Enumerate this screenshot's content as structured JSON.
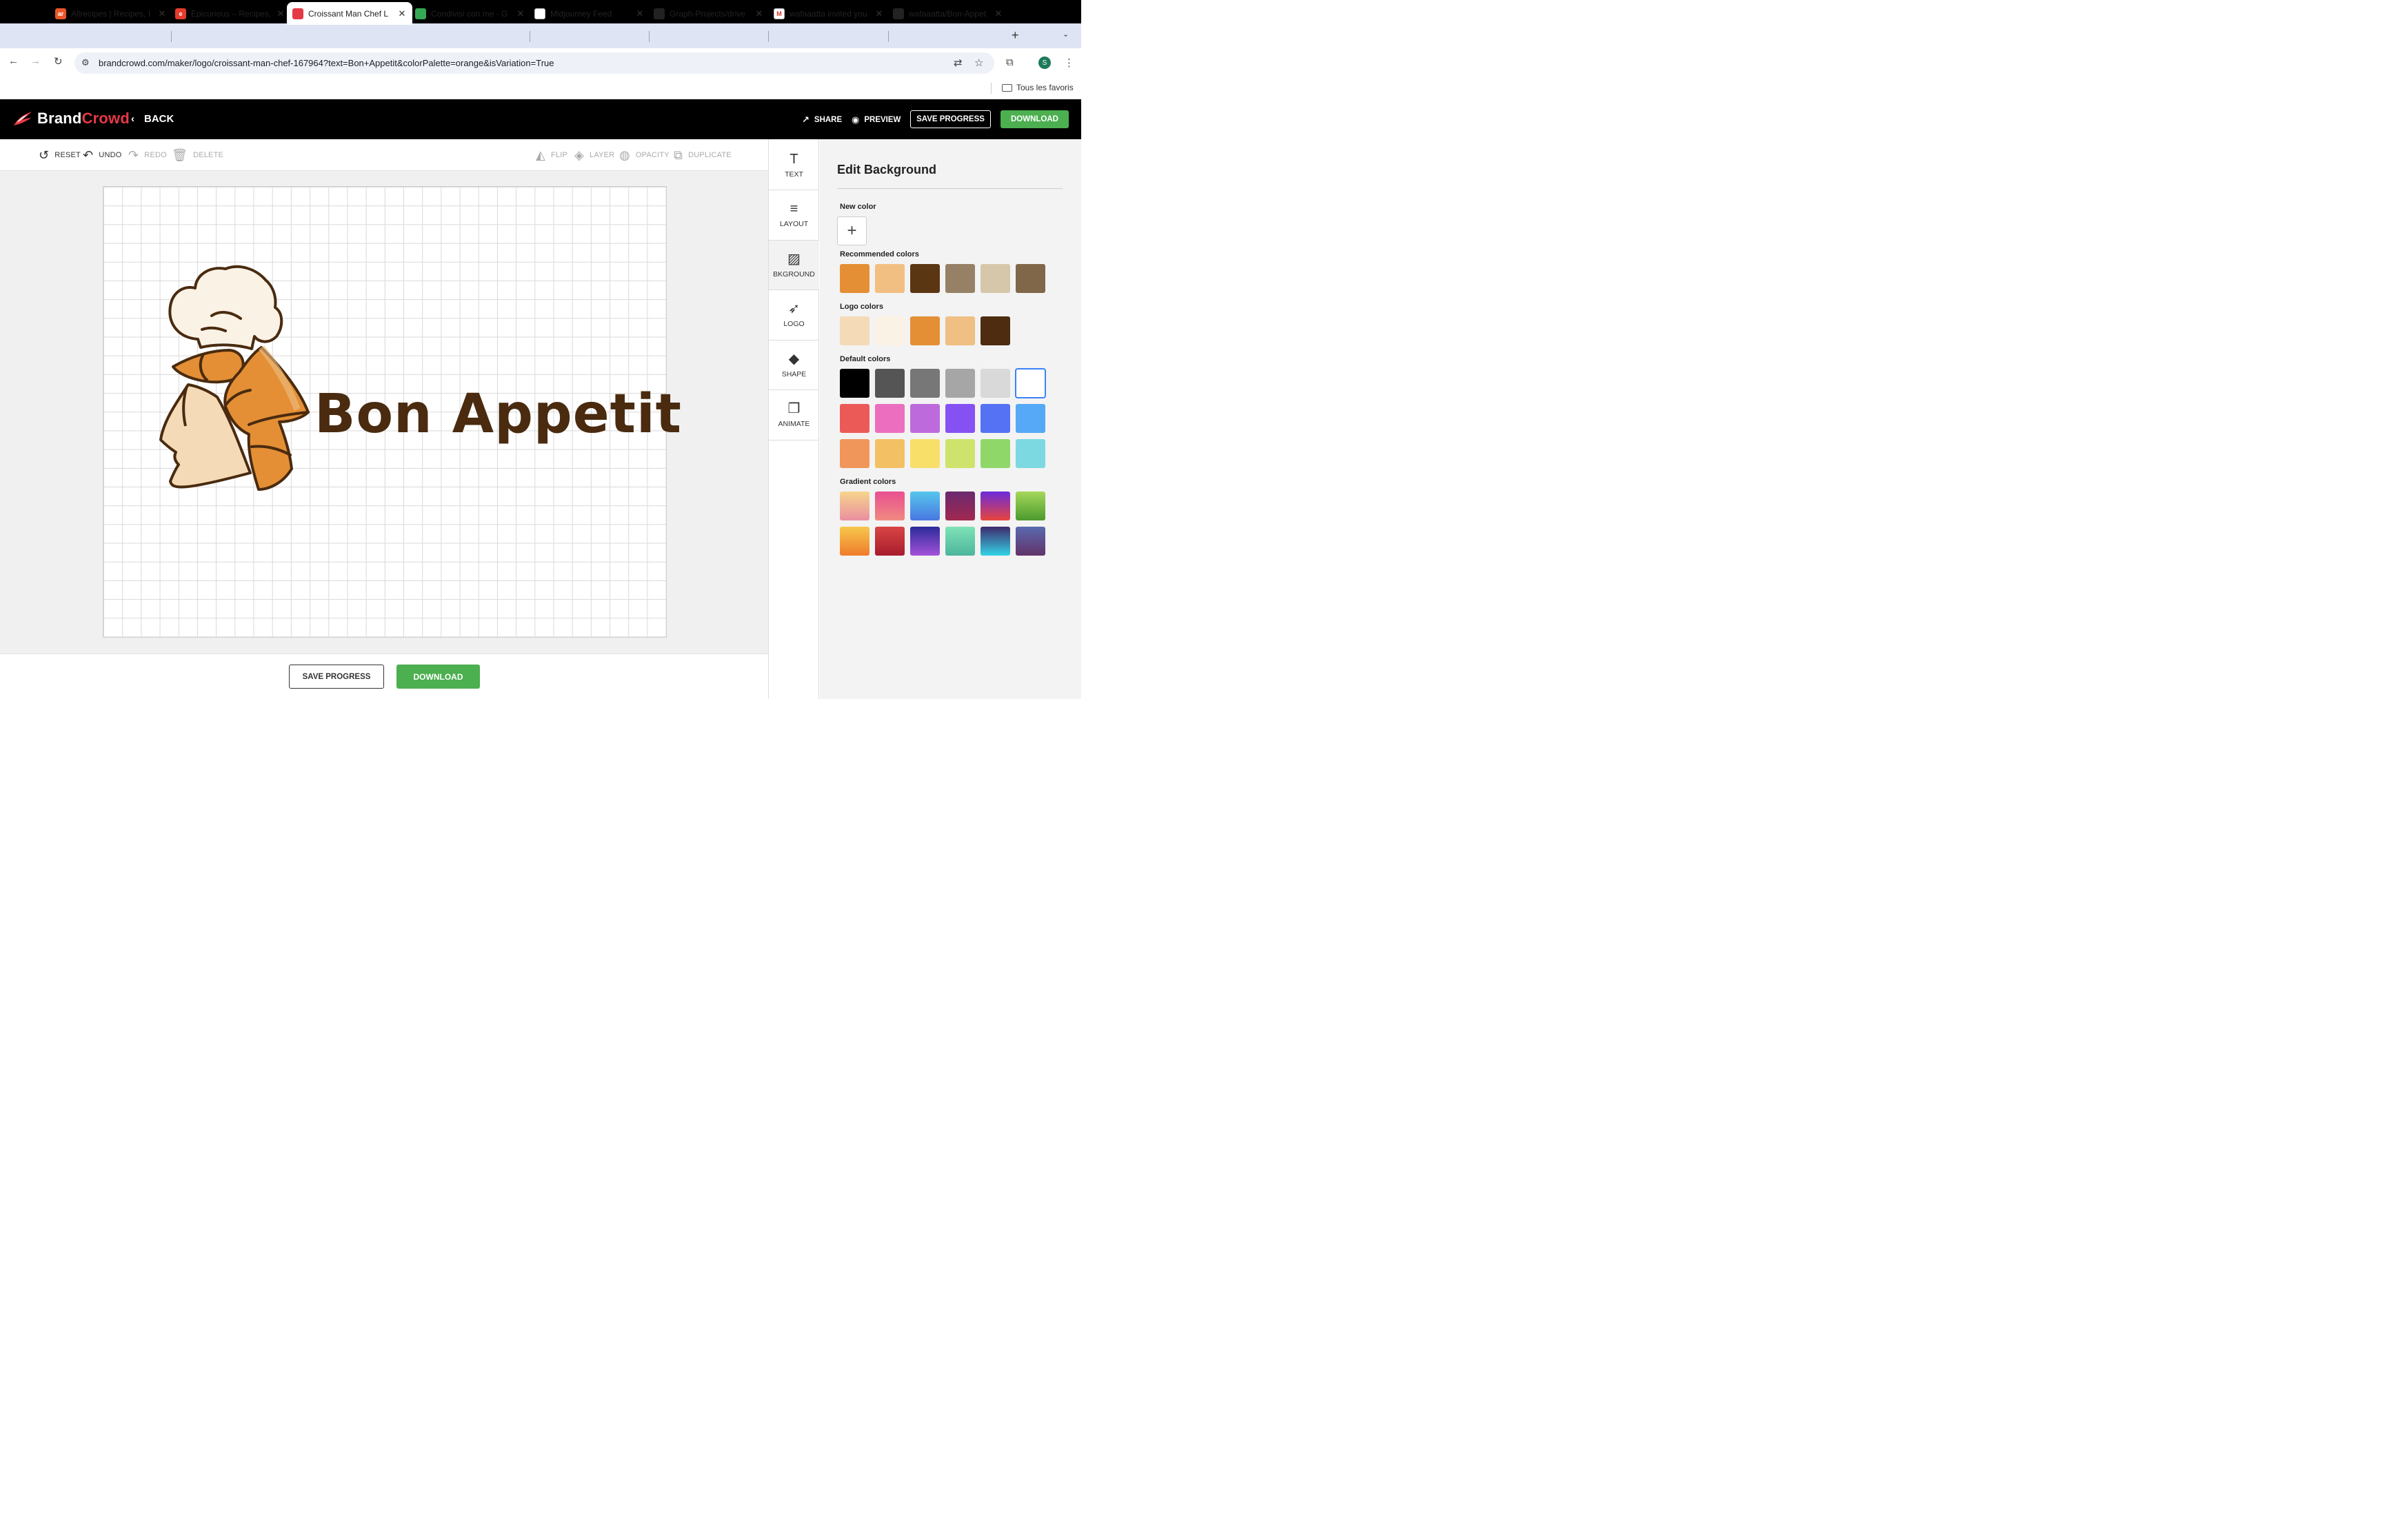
{
  "browser": {
    "tabs": [
      {
        "title": "Allrecipes | Recipes, I",
        "fav": "ar",
        "fav_color": "#e8562a"
      },
      {
        "title": "Epicurious – Recipes,",
        "fav": "e",
        "fav_color": "#e33b2c"
      },
      {
        "title": "Croissant Man Chef L",
        "fav": "",
        "fav_color": "#e63946"
      },
      {
        "title": "Condivisi con me - G",
        "fav": "",
        "fav_color": "#34a853"
      },
      {
        "title": "Midjourney Feed",
        "fav": "",
        "fav_color": "#ffffff"
      },
      {
        "title": "Graph-Projects/drive",
        "fav": "",
        "fav_color": "#222222"
      },
      {
        "title": "wafaaatta invited you",
        "fav": "M",
        "fav_color": "#ffffff"
      },
      {
        "title": "wafaaatta/Bon-Appet",
        "fav": "",
        "fav_color": "#222222"
      }
    ],
    "url": "brandcrowd.com/maker/logo/croissant-man-chef-167964?text=Bon+Appetit&colorPalette=orange&isVariation=True",
    "bookmark_label": "Tous les favoris",
    "avatar_letter": "S"
  },
  "app": {
    "brand_a": "Brand",
    "brand_b": "Crowd",
    "back_label": "BACK",
    "share_label": "SHARE",
    "preview_label": "PREVIEW",
    "save_label": "SAVE PROGRESS",
    "download_label": "DOWNLOAD",
    "brand_color": "#e63946",
    "green": "#4caf50"
  },
  "toolbar": {
    "reset": "RESET",
    "undo": "UNDO",
    "redo": "REDO",
    "delete": "DELETE",
    "flip": "FLIP",
    "layer": "LAYER",
    "opacity": "OPACITY",
    "duplicate": "DUPLICATE"
  },
  "canvas": {
    "logo_text": "Bon Appetit",
    "text_color": "#4a2b0f"
  },
  "bottom": {
    "save_label": "SAVE PROGRESS",
    "download_label": "DOWNLOAD"
  },
  "side_tabs": [
    {
      "label": "TEXT",
      "icon": "text-icon"
    },
    {
      "label": "LAYOUT",
      "icon": "layout-icon"
    },
    {
      "label": "BKGROUND",
      "icon": "background-icon"
    },
    {
      "label": "LOGO",
      "icon": "logo-icon"
    },
    {
      "label": "SHAPE",
      "icon": "shape-icon"
    },
    {
      "label": "ANIMATE",
      "icon": "animate-icon"
    }
  ],
  "panel": {
    "title": "Edit Background",
    "new_color_label": "New color",
    "recommended_label": "Recommended colors",
    "logo_colors_label": "Logo colors",
    "default_label": "Default colors",
    "gradient_label": "Gradient colors",
    "recommended": [
      "#e48f35",
      "#f2bf82",
      "#5b3613",
      "#968166",
      "#d6c7ab",
      "#806749"
    ],
    "logo_colors": [
      "#f5dab8",
      "#fbf2e6",
      "#e48f35",
      "#efbf84",
      "#4d2c10"
    ],
    "default_colors": [
      "#000000",
      "#555555",
      "#777777",
      "#a6a6a6",
      "#d9d9d9",
      "#ffffff",
      "#ec5a57",
      "#ec6fbf",
      "#bd6bdc",
      "#8651f3",
      "#5472f3",
      "#56a9f6",
      "#f0965a",
      "#f4c064",
      "#f8df6a",
      "#cde36c",
      "#90d769",
      "#7dd9e1"
    ],
    "gradients": [
      [
        "#f7d58b",
        "#e98fa0"
      ],
      [
        "#e94f91",
        "#f08a80"
      ],
      [
        "#56c7ec",
        "#4977e2"
      ],
      [
        "#6b2a70",
        "#a1284f"
      ],
      [
        "#6b2bdc",
        "#e8453c"
      ],
      [
        "#a5d85b",
        "#4c9a2e"
      ],
      [
        "#f7c84c",
        "#ef7b2c"
      ],
      [
        "#d94545",
        "#a81c2c"
      ],
      [
        "#2b2b9a",
        "#a452d9"
      ],
      [
        "#7fe2b7",
        "#4cb59c"
      ],
      [
        "#3f2a6d",
        "#33d3e7"
      ],
      [
        "#5a6ab0",
        "#62336a"
      ]
    ]
  }
}
